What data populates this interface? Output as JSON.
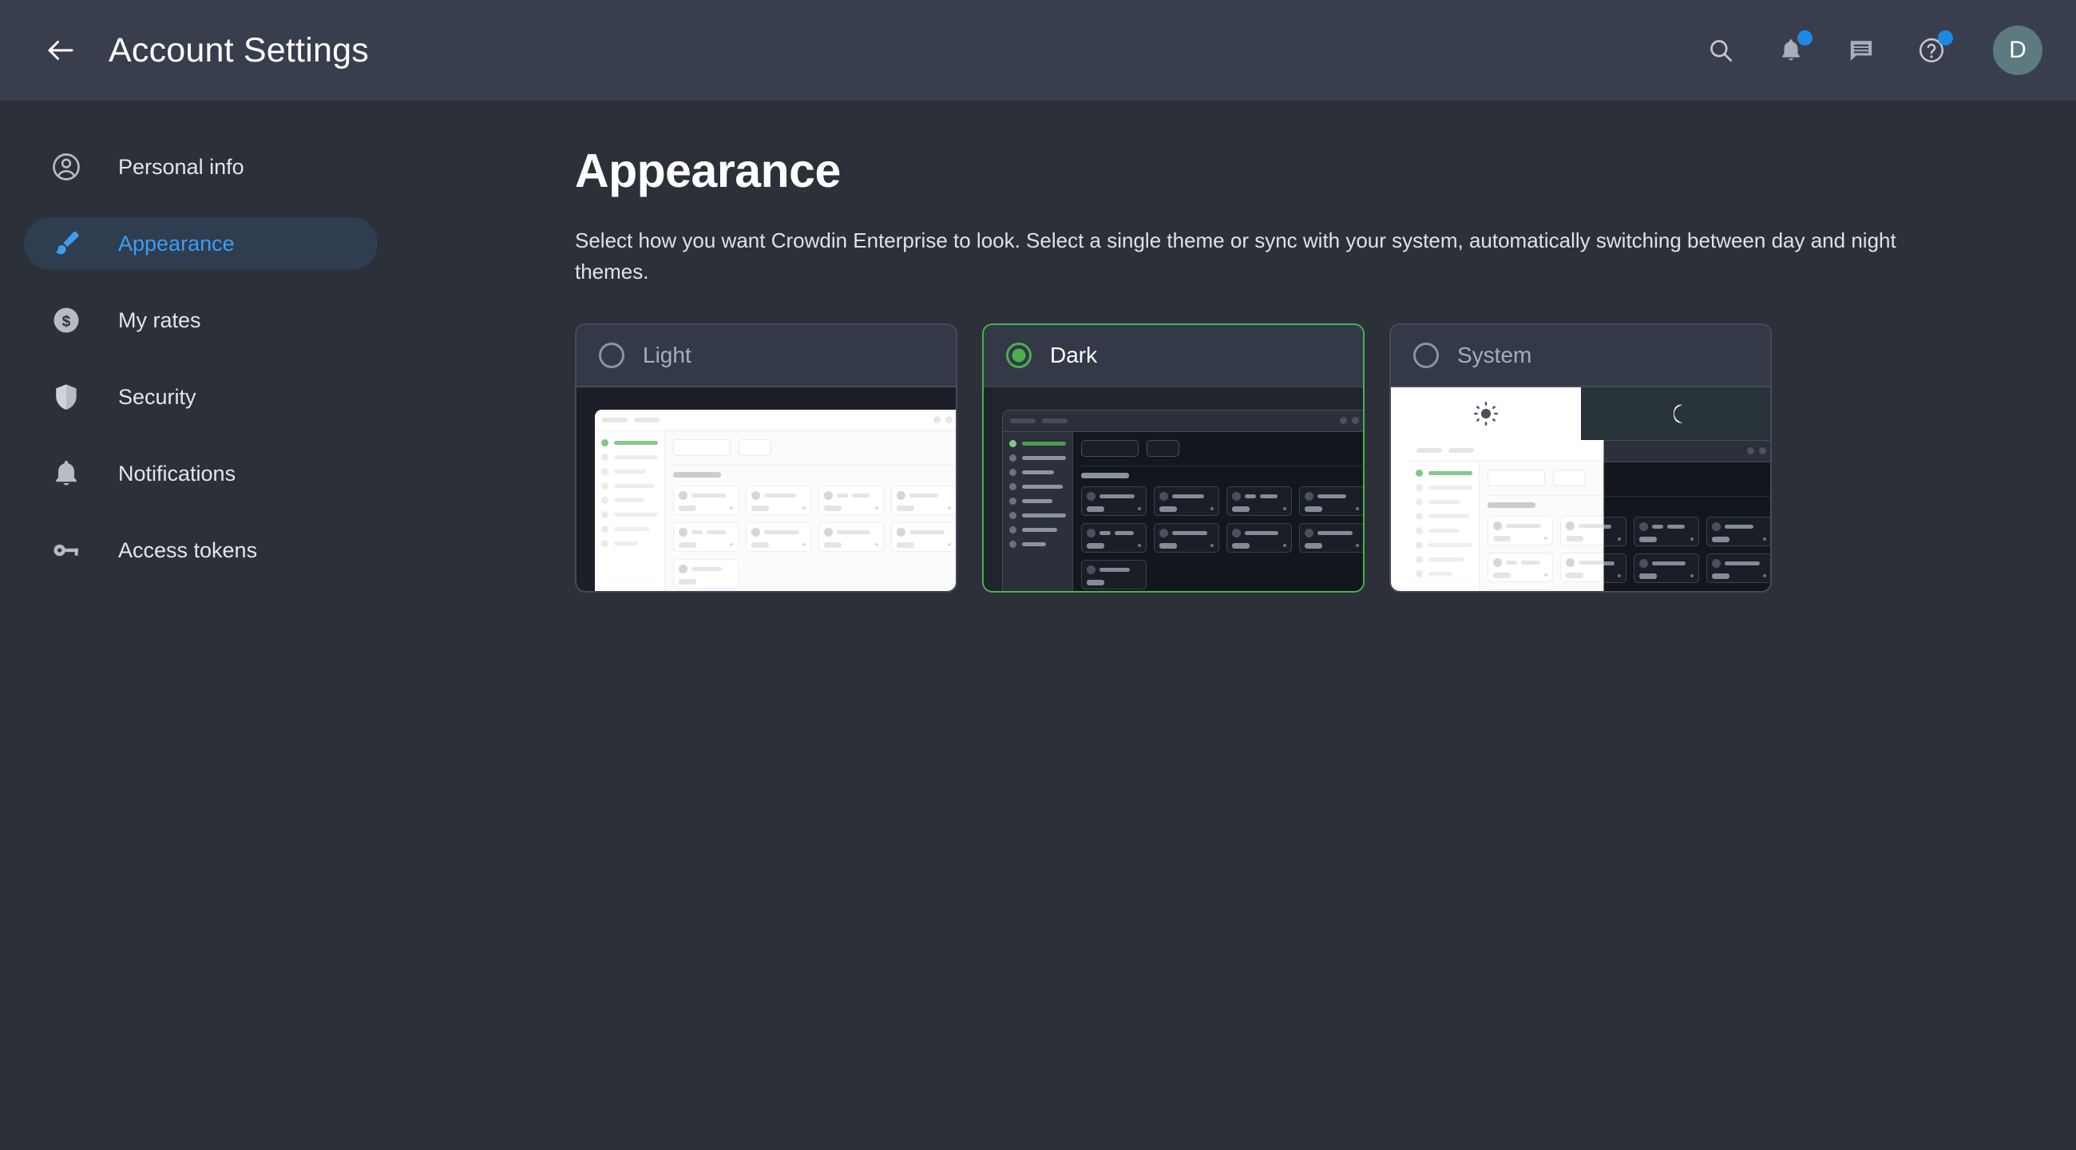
{
  "header": {
    "back_icon": "arrow-left-icon",
    "title": "Account Settings",
    "actions": [
      {
        "name": "search-icon",
        "label": "Search",
        "badge": false
      },
      {
        "name": "bell-icon",
        "label": "Notifications",
        "badge": true
      },
      {
        "name": "chat-icon",
        "label": "Messages",
        "badge": false
      },
      {
        "name": "help-icon",
        "label": "Help",
        "badge": true
      }
    ],
    "avatar_initial": "D"
  },
  "sidebar": {
    "items": [
      {
        "label": "Personal info",
        "icon": "user-circle-icon",
        "active": false
      },
      {
        "label": "Appearance",
        "icon": "brush-icon",
        "active": true
      },
      {
        "label": "My rates",
        "icon": "dollar-coin-icon",
        "active": false
      },
      {
        "label": "Security",
        "icon": "shield-icon",
        "active": false
      },
      {
        "label": "Notifications",
        "icon": "bell-icon",
        "active": false
      },
      {
        "label": "Access tokens",
        "icon": "key-icon",
        "active": false
      }
    ]
  },
  "main": {
    "title": "Appearance",
    "description": "Select how you want Crowdin Enterprise to look. Select a single theme or sync with your system, automatically switching between day and night themes.",
    "themes": [
      {
        "label": "Light",
        "selected": false,
        "preview": "light"
      },
      {
        "label": "Dark",
        "selected": true,
        "preview": "dark"
      },
      {
        "label": "System",
        "selected": false,
        "preview": "system"
      }
    ]
  },
  "colors": {
    "header_bg": "#383e4b",
    "page_bg": "#2b3039",
    "accent_blue": "#3e9cf0",
    "accent_green": "#4caf50",
    "badge_blue": "#1e88e5",
    "avatar_bg": "#5c7b7e",
    "card_bg": "#22262f",
    "card_head_bg": "#333947",
    "card_border": "#444b59"
  },
  "icons": {
    "sun": "sun-icon",
    "moon": "moon-icon"
  }
}
